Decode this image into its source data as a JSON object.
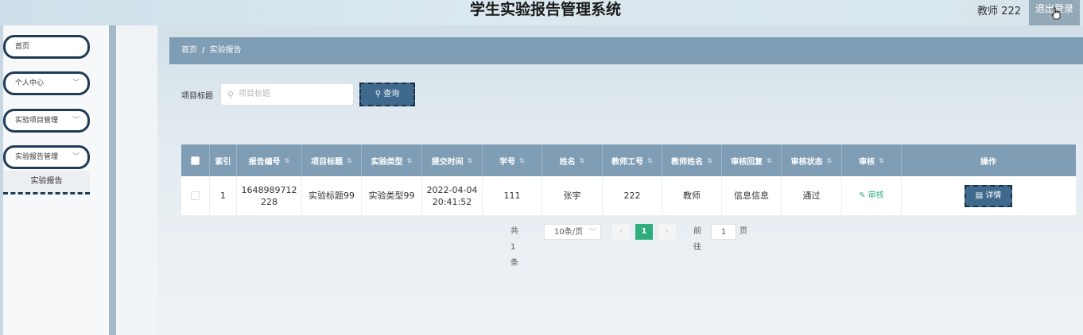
{
  "header": {
    "title": "学生实验报告管理系统",
    "user": "教师 222",
    "logout": "退出登录"
  },
  "sidebar": {
    "items": [
      {
        "label": "首页",
        "has_children": false
      },
      {
        "label": "个人中心",
        "has_children": true
      },
      {
        "label": "实验项目管理",
        "has_children": true
      },
      {
        "label": "实验报告管理",
        "has_children": true
      }
    ],
    "sub_item": "实验报告"
  },
  "breadcrumb": {
    "home": "首页",
    "sep": "/",
    "current": "实验报告"
  },
  "search": {
    "label": "项目标题",
    "placeholder": "项目标题",
    "button": "查询"
  },
  "table": {
    "headers": [
      "索引",
      "报告编号",
      "项目标题",
      "实验类型",
      "提交时间",
      "学号",
      "姓名",
      "教师工号",
      "教师姓名",
      "审核回复",
      "审核状态",
      "审核",
      "操作"
    ],
    "rows": [
      {
        "index": "1",
        "report_no_line1": "1648989712",
        "report_no_line2": "228",
        "project_title": "实验标题99",
        "exp_type": "实验类型99",
        "submit_date": "2022-04-04",
        "submit_time": "20:41:52",
        "student_no": "111",
        "name": "张宇",
        "teacher_no": "222",
        "teacher_name": "教师",
        "review_reply": "信息信息",
        "review_status": "通过",
        "review_action": "审核",
        "detail_action": "详情"
      }
    ]
  },
  "pagination": {
    "total": "共 1 条",
    "page_size": "10条/页",
    "current_page": "1",
    "goto_label": "前往",
    "goto_value": "1",
    "page_unit": "页"
  },
  "colors": {
    "accent": "#7f9db4",
    "button": "#3f6a8e",
    "success": "#2fae7c"
  }
}
